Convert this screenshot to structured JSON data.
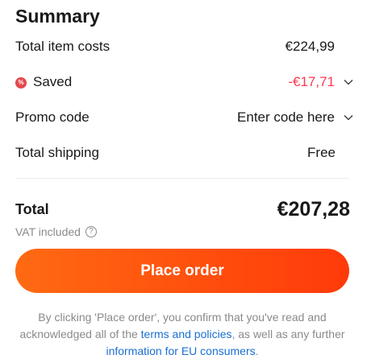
{
  "summary": {
    "title": "Summary",
    "item_costs": {
      "label": "Total item costs",
      "value": "€224,99"
    },
    "saved": {
      "label": "Saved",
      "value": "-€17,71",
      "badge": "%",
      "color": "#fd384f"
    },
    "promo": {
      "label": "Promo code",
      "value": "Enter code here"
    },
    "shipping": {
      "label": "Total shipping",
      "value": "Free"
    },
    "total": {
      "label": "Total",
      "value": "€207,28"
    },
    "vat": {
      "label": "VAT included",
      "help_icon": "?"
    }
  },
  "checkout": {
    "button_label": "Place order",
    "button_color": "#ff4a10"
  },
  "legal": {
    "text_1": "By clicking 'Place order', you confirm that you've read and acknowledged all of the ",
    "link_terms": "terms and policies",
    "text_2": ", as well as any further ",
    "link_eu": "information for EU consumers",
    "text_3": "."
  }
}
